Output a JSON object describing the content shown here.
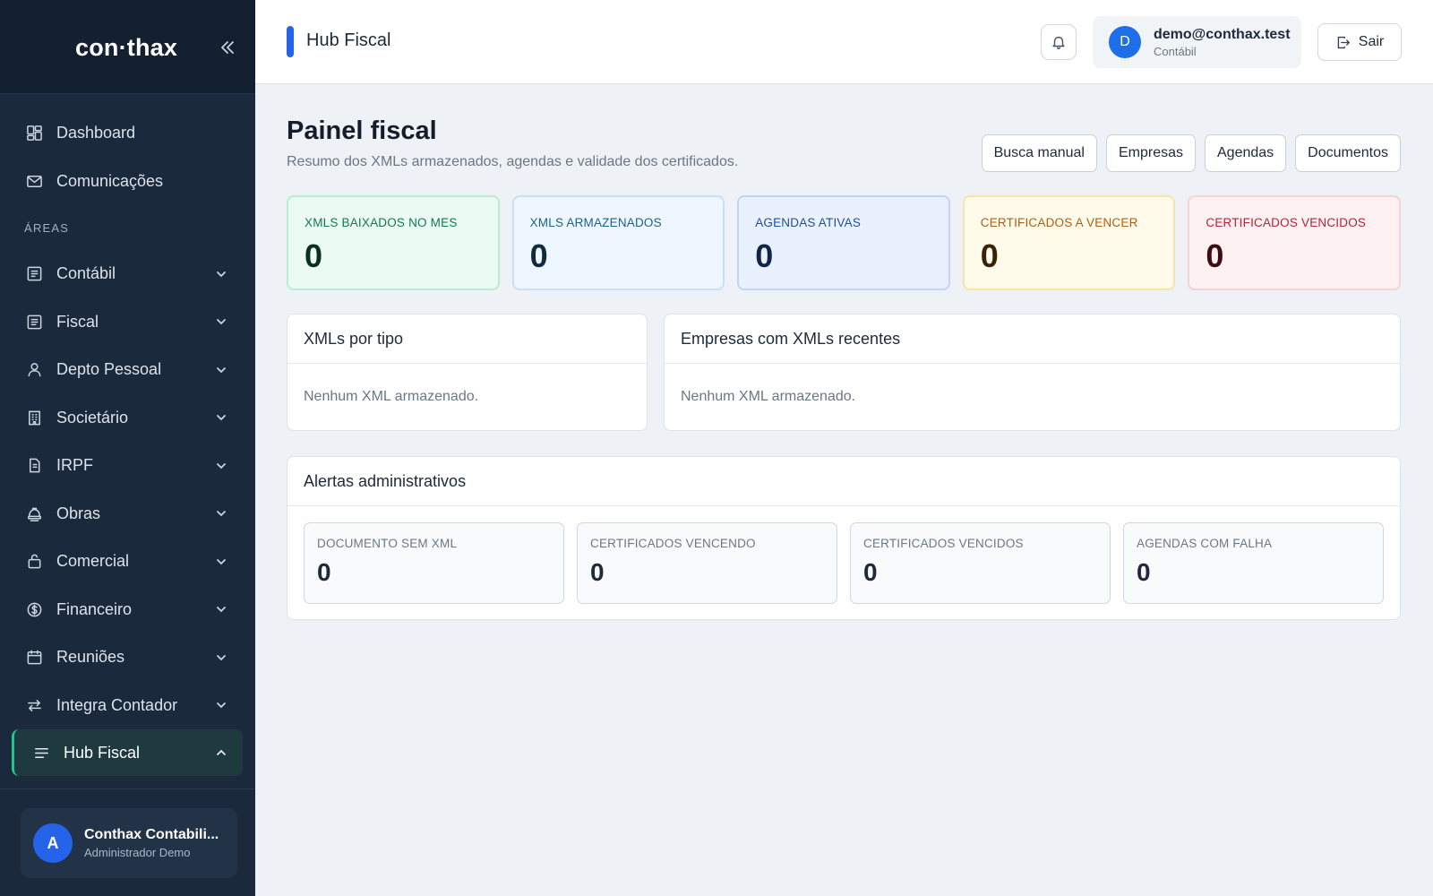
{
  "brand": {
    "logo": "con·thax"
  },
  "sidebar": {
    "top_items": [
      {
        "label": "Dashboard",
        "icon": "dashboard-icon"
      },
      {
        "label": "Comunicações",
        "icon": "mail-icon"
      }
    ],
    "section_label": "ÁREAS",
    "areas": [
      {
        "label": "Contábil",
        "icon": "ledger-icon"
      },
      {
        "label": "Fiscal",
        "icon": "receipt-icon"
      },
      {
        "label": "Depto Pessoal",
        "icon": "user-icon"
      },
      {
        "label": "Societário",
        "icon": "building-icon"
      },
      {
        "label": "IRPF",
        "icon": "document-icon"
      },
      {
        "label": "Obras",
        "icon": "construction-icon"
      },
      {
        "label": "Comercial",
        "icon": "bag-icon"
      },
      {
        "label": "Financeiro",
        "icon": "currency-icon"
      },
      {
        "label": "Reuniões",
        "icon": "calendar-icon"
      },
      {
        "label": "Integra Contador",
        "icon": "arrows-icon"
      },
      {
        "label": "Hub Fiscal",
        "icon": "menu-lines-icon",
        "active": true
      }
    ],
    "user": {
      "initial": "A",
      "name": "Conthax Contabili...",
      "role": "Administrador Demo"
    }
  },
  "topbar": {
    "title": "Hub Fiscal",
    "account": {
      "initial": "D",
      "email": "demo@conthax.test",
      "role": "Contábil"
    },
    "logout_label": "Sair"
  },
  "page": {
    "title": "Painel fiscal",
    "subtitle": "Resumo dos XMLs armazenados, agendas e validade dos certificados.",
    "actions": [
      "Busca manual",
      "Empresas",
      "Agendas",
      "Documentos"
    ]
  },
  "stats": [
    {
      "label": "XMLS BAIXADOS NO MES",
      "value": "0"
    },
    {
      "label": "XMLS ARMAZENADOS",
      "value": "0"
    },
    {
      "label": "AGENDAS ATIVAS",
      "value": "0"
    },
    {
      "label": "CERTIFICADOS A VENCER",
      "value": "0"
    },
    {
      "label": "CERTIFICADOS VENCIDOS",
      "value": "0"
    }
  ],
  "panels": {
    "by_type": {
      "title": "XMLs por tipo",
      "empty": "Nenhum XML armazenado."
    },
    "recent": {
      "title": "Empresas com XMLs recentes",
      "empty": "Nenhum XML armazenado."
    },
    "alerts": {
      "title": "Alertas administrativos",
      "items": [
        {
          "label": "DOCUMENTO SEM XML",
          "value": "0"
        },
        {
          "label": "CERTIFICADOS VENCENDO",
          "value": "0"
        },
        {
          "label": "CERTIFICADOS VENCIDOS",
          "value": "0"
        },
        {
          "label": "AGENDAS COM FALHA",
          "value": "0"
        }
      ]
    }
  },
  "colors": {
    "accent": "#2563eb",
    "sidebar_bg": "#1a2a3c",
    "active_indicator": "#22c58b"
  }
}
